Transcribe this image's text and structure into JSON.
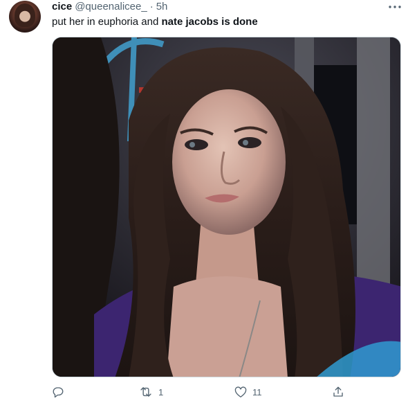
{
  "tweet": {
    "author": {
      "display_name": "cice",
      "handle": "@queenalicee_",
      "separator": "·",
      "time": "5h"
    },
    "text": {
      "normal": "put her in euphoria and ",
      "bold": "nate jacobs is done"
    },
    "media": {
      "alt": "Photo of a young woman with long dark hair on a bus"
    },
    "actions": {
      "reply_count": "",
      "retweet_count": "1",
      "like_count": "11"
    }
  },
  "colors": {
    "text_primary": "#0f1419",
    "text_secondary": "#536471",
    "border": "#cfd9de"
  },
  "icons": {
    "more": "more-dots-icon",
    "reply": "reply-icon",
    "retweet": "retweet-icon",
    "like": "heart-icon",
    "share": "share-icon"
  }
}
